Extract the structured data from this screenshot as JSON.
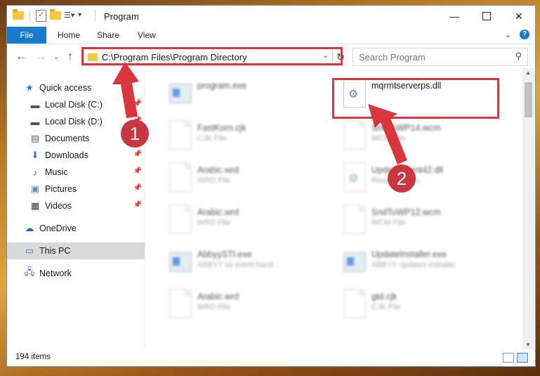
{
  "window": {
    "title": "Program"
  },
  "ribbon": {
    "tabs": [
      "File",
      "Home",
      "Share",
      "View"
    ]
  },
  "address": {
    "path": "C:\\Program Files\\Program Directory"
  },
  "search": {
    "placeholder": "Search Program"
  },
  "sidebar": {
    "items": [
      {
        "label": "Quick access",
        "icon": "star-icon",
        "pinned": false
      },
      {
        "label": "Local Disk (C:)",
        "icon": "drive-icon",
        "pinned": true
      },
      {
        "label": "Local Disk (D:)",
        "icon": "drive-icon",
        "pinned": true
      },
      {
        "label": "Documents",
        "icon": "documents-icon",
        "pinned": true
      },
      {
        "label": "Downloads",
        "icon": "download-icon",
        "pinned": true
      },
      {
        "label": "Music",
        "icon": "music-icon",
        "pinned": true
      },
      {
        "label": "Pictures",
        "icon": "pictures-icon",
        "pinned": true
      },
      {
        "label": "Videos",
        "icon": "videos-icon",
        "pinned": true
      },
      {
        "label": "OneDrive",
        "icon": "cloud-icon",
        "pinned": false
      },
      {
        "label": "This PC",
        "icon": "computer-icon",
        "pinned": false,
        "selected": true
      },
      {
        "label": "Network",
        "icon": "network-icon",
        "pinned": false
      }
    ]
  },
  "files": [
    {
      "name": "program.exe",
      "type": "",
      "icon": "exe-icon"
    },
    {
      "name": "mqrmtserverps.dll",
      "type": "",
      "icon": "dll-gear-icon"
    },
    {
      "name": "FastKorn.cjk",
      "type": "CJK File",
      "icon": "document-icon"
    },
    {
      "name": "SndToWP14.wcm",
      "type": "WCM File",
      "icon": "document-icon"
    },
    {
      "name": "Arabic.wrd",
      "type": "WRD File",
      "icon": "document-icon"
    },
    {
      "name": "UpdateClient42.dll",
      "type": "Resource DLL",
      "icon": "dll-gear-icon"
    },
    {
      "name": "Arabic.wrd",
      "type": "WRD File",
      "icon": "document-icon"
    },
    {
      "name": "SndToWP12.wcm",
      "type": "WCM File",
      "icon": "document-icon"
    },
    {
      "name": "AbbyySTI.exe",
      "type": "ABBYY sti event hand...",
      "icon": "exe-icon"
    },
    {
      "name": "UpdateInstaller.exe",
      "type": "ABBYY updates installer",
      "icon": "exe-icon"
    },
    {
      "name": "Arabic.wrd",
      "type": "WRD File",
      "icon": "document-icon"
    },
    {
      "name": "gtd.cjk",
      "type": "CJK File",
      "icon": "document-icon"
    }
  ],
  "status": {
    "item_count": "194 items"
  },
  "annotations": {
    "step1": "1",
    "step2": "2",
    "highlight_color": "#d9363e"
  }
}
